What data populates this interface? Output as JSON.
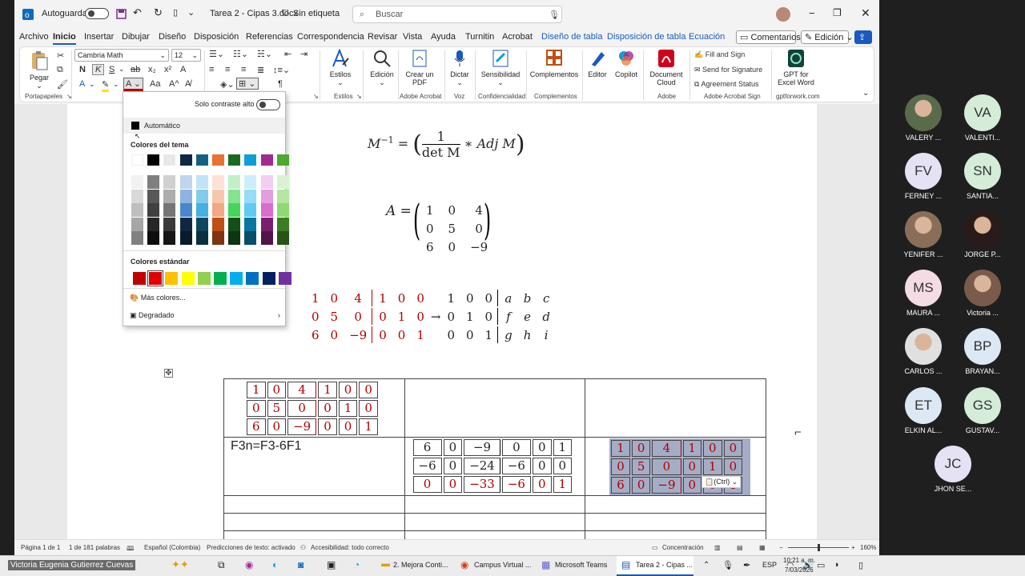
{
  "titlebar": {
    "autosave_label": "Autoguardado",
    "doc_title": "Tarea 2 - Cipas 3.docx",
    "sensitivity": "Sin etiqueta",
    "search_placeholder": "Buscar"
  },
  "menus": [
    "Archivo",
    "Inicio",
    "Insertar",
    "Dibujar",
    "Diseño",
    "Disposición",
    "Referencias",
    "Correspondencia",
    "Revisar",
    "Vista",
    "Ayuda",
    "Turnitin",
    "Acrobat"
  ],
  "context_menus": [
    "Diseño de tabla",
    "Disposición de tabla",
    "Ecuación"
  ],
  "menu_buttons": {
    "comments": "Comentarios",
    "editing": "Edición"
  },
  "ribbon": {
    "paste": "Pegar",
    "font_name": "Cambria Math",
    "font_size": "12",
    "groups": {
      "clipboard": "Portapapeles",
      "styles": "Estilos",
      "adobe_acrobat": "Adobe Acrobat",
      "voice": "Voz",
      "confidentiality": "Confidencialidad",
      "addins": "Complementos",
      "adobe": "Adobe",
      "adobe_sign": "Adobe Acrobat Sign",
      "gpt": "gptforwork.com"
    },
    "styles_btn": "Estilos",
    "editing_btn": "Edición",
    "create_pdf": "Crear un PDF",
    "dictate": "Dictar",
    "sensitivity": "Sensibilidad",
    "addins": "Complementos",
    "editor": "Editor",
    "copilot": "Copilot",
    "document_cloud": "Document Cloud",
    "fill_sign": "Fill and Sign",
    "send_signature": "Send for Signature",
    "agreement_status": "Agreement Status",
    "gpt_excel": "GPT for Excel Word"
  },
  "color_picker": {
    "high_contrast": "Solo contraste alto",
    "automatic": "Automático",
    "theme_colors": "Colores del tema",
    "standard_colors": "Colores estándar",
    "more_colors": "Más colores...",
    "gradient": "Degradado",
    "theme_top": [
      "#ffffff",
      "#000000",
      "#e8e8e8",
      "#0e2841",
      "#156082",
      "#e97132",
      "#196b24",
      "#0f9ed5",
      "#a02b93",
      "#4ea72e"
    ],
    "theme_shades": [
      [
        "#f2f2f2",
        "#7f7f7f",
        "#d0d0d0",
        "#c0d4ec",
        "#c1e4f5",
        "#fbe2d5",
        "#c1f0c8",
        "#caeefb",
        "#f2ceef",
        "#daf2d0"
      ],
      [
        "#d9d9d9",
        "#595959",
        "#adadad",
        "#8db3e2",
        "#83cbeb",
        "#f7c7ac",
        "#84e291",
        "#95dcf7",
        "#e59edd",
        "#b5e6a2"
      ],
      [
        "#bfbfbf",
        "#404040",
        "#757575",
        "#4a86cf",
        "#45b0e1",
        "#f1a983",
        "#47d45a",
        "#60caf3",
        "#d86dcb",
        "#8ed973"
      ],
      [
        "#a6a6a6",
        "#262626",
        "#3a3a3a",
        "#0e2841",
        "#0f4761",
        "#c04f15",
        "#124f1a",
        "#0b76a0",
        "#78206e",
        "#3b7d23"
      ],
      [
        "#808080",
        "#0d0d0d",
        "#171717",
        "#091a2b",
        "#0a2f40",
        "#803410",
        "#0c3511",
        "#074f6a",
        "#501549",
        "#275317"
      ]
    ],
    "standard": [
      "#c00000",
      "#e00000",
      "#ffc000",
      "#ffff00",
      "#92d050",
      "#00b050",
      "#00b0f0",
      "#0070c0",
      "#002060",
      "#7030a0"
    ]
  },
  "document": {
    "inverse_eq": {
      "lhs": "M",
      "sup": "−1",
      "eq": "=",
      "num": "1",
      "den": "det M",
      "rhs": "∗ Adj M"
    },
    "a_eq": {
      "lhs": "A =",
      "rows": [
        [
          "1",
          "0",
          "4"
        ],
        [
          "0",
          "5",
          "0"
        ],
        [
          "6",
          "0",
          "−9"
        ]
      ]
    },
    "augmented": {
      "left": [
        [
          "1",
          "0",
          "4"
        ],
        [
          "0",
          "5",
          "0"
        ],
        [
          "6",
          "0",
          "−9"
        ]
      ],
      "mid": [
        [
          "1",
          "0",
          "0"
        ],
        [
          "0",
          "1",
          "0"
        ],
        [
          "0",
          "0",
          "1"
        ]
      ],
      "arrow": "→",
      "right": [
        [
          "1",
          "0",
          "0"
        ],
        [
          "0",
          "1",
          "0"
        ],
        [
          "0",
          "0",
          "1"
        ]
      ],
      "vars": [
        [
          "a",
          "b",
          "c"
        ],
        [
          "f",
          "e",
          "d"
        ],
        [
          "g",
          "h",
          "i"
        ]
      ]
    },
    "table": {
      "cell1": {
        "left": [
          [
            "1",
            "0",
            "4"
          ],
          [
            "0",
            "5",
            "0"
          ],
          [
            "6",
            "0",
            "−9"
          ]
        ],
        "right": [
          [
            "1",
            "0",
            "0"
          ],
          [
            "0",
            "1",
            "0"
          ],
          [
            "0",
            "0",
            "1"
          ]
        ]
      },
      "op": "F3n=F3-6F1",
      "cell2": {
        "rows": [
          [
            "6",
            "0",
            "−9",
            "0",
            "0",
            "1"
          ],
          [
            "−6",
            "0",
            "−24",
            "−6",
            "0",
            "0"
          ],
          [
            "0",
            "0",
            "−33",
            "−6",
            "0",
            "1"
          ]
        ]
      },
      "cell3": {
        "left": [
          [
            "1",
            "0",
            "4"
          ],
          [
            "0",
            "5",
            "0"
          ],
          [
            "6",
            "0",
            "−9"
          ]
        ],
        "right": [
          [
            "1",
            "0",
            "0"
          ],
          [
            "0",
            "1",
            "0"
          ],
          [
            "0",
            "0",
            "1"
          ]
        ]
      },
      "paste_opt": "(Ctrl)"
    }
  },
  "statusbar": {
    "page": "Página 1 de 1",
    "words": "1 de 181 palabras",
    "lang": "Español (Colombia)",
    "predictions": "Predicciones de texto: activado",
    "accessibility": "Accesibilidad: todo correcto",
    "focus": "Concentración",
    "zoom": "160%"
  },
  "taskbar": {
    "presenter": "Victoria Eugenia Gutierrez Cuevas",
    "task1": "2. Mejora Conti...",
    "task2": "Campus Virtual ...",
    "task3": "Microsoft Teams",
    "task4": "Tarea 2 - Cipas ...",
    "lang": "ESP",
    "time": "10:21 a. m.",
    "date": "7/03/2026"
  },
  "participants": [
    {
      "initials": "",
      "name": "VALERY ...",
      "photo": true,
      "color": "#5a6b4c"
    },
    {
      "initials": "VA",
      "name": "VALENTI...",
      "photo": false,
      "color": "#d4ecd8"
    },
    {
      "initials": "FV",
      "name": "FERNEY ...",
      "photo": false,
      "color": "#e4e2f4"
    },
    {
      "initials": "SN",
      "name": "SANTIA...",
      "photo": false,
      "color": "#d4ecd8"
    },
    {
      "initials": "",
      "name": "YENIFER ...",
      "photo": true,
      "color": "#8a6e5a"
    },
    {
      "initials": "",
      "name": "JORGE P...",
      "photo": true,
      "color": "#2a1a1a"
    },
    {
      "initials": "MS",
      "name": "MAURA ...",
      "photo": false,
      "color": "#f4dce4"
    },
    {
      "initials": "",
      "name": "Victoria ...",
      "photo": true,
      "color": "#7a5a4a"
    },
    {
      "initials": "",
      "name": "CARLOS ...",
      "photo": true,
      "color": "#e0e0e0"
    },
    {
      "initials": "BP",
      "name": "BRAYAN...",
      "photo": false,
      "color": "#dce8f4"
    },
    {
      "initials": "ET",
      "name": "ELKIN AL...",
      "photo": false,
      "color": "#dce8f4"
    },
    {
      "initials": "GS",
      "name": "GUSTAV...",
      "photo": false,
      "color": "#d4ecd8"
    },
    {
      "initials": "JC",
      "name": "JHON SE...",
      "photo": false,
      "color": "#e4e2f4"
    }
  ]
}
